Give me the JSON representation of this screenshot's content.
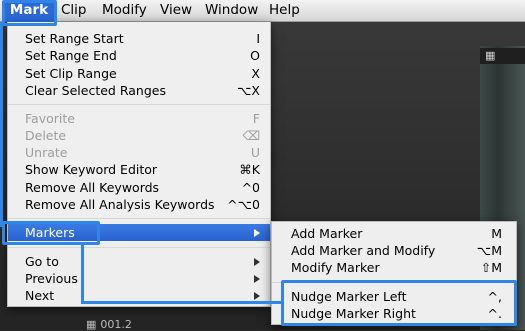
{
  "menubar": {
    "items": [
      {
        "label": "Mark",
        "active": true
      },
      {
        "label": "Clip"
      },
      {
        "label": "Modify"
      },
      {
        "label": "View"
      },
      {
        "label": "Window"
      },
      {
        "label": "Help"
      }
    ]
  },
  "mark_menu": {
    "set_range_start": {
      "label": "Set Range Start",
      "shortcut": "I"
    },
    "set_range_end": {
      "label": "Set Range End",
      "shortcut": "O"
    },
    "set_clip_range": {
      "label": "Set Clip Range",
      "shortcut": "X"
    },
    "clear_selected_ranges": {
      "label": "Clear Selected Ranges",
      "shortcut": "⌥X"
    },
    "favorite": {
      "label": "Favorite",
      "shortcut": "F",
      "enabled": false
    },
    "delete": {
      "label": "Delete",
      "shortcut": "⌫",
      "enabled": false
    },
    "unrate": {
      "label": "Unrate",
      "shortcut": "U",
      "enabled": false
    },
    "show_keyword_editor": {
      "label": "Show Keyword Editor",
      "shortcut": "⌘K"
    },
    "remove_all_keywords": {
      "label": "Remove All Keywords",
      "shortcut": "^0"
    },
    "remove_all_analysis_keywords": {
      "label": "Remove All Analysis Keywords",
      "shortcut": "^⌥0"
    },
    "markers": {
      "label": "Markers",
      "highlighted": true
    },
    "go_to": {
      "label": "Go to"
    },
    "previous": {
      "label": "Previous"
    },
    "next": {
      "label": "Next"
    }
  },
  "markers_submenu": {
    "add_marker": {
      "label": "Add Marker",
      "shortcut": "M"
    },
    "add_marker_and_modify": {
      "label": "Add Marker and Modify",
      "shortcut": "⌥M"
    },
    "modify_marker": {
      "label": "Modify Marker",
      "shortcut": "⇧M"
    },
    "nudge_marker_left": {
      "label": "Nudge Marker Left",
      "shortcut": "^,"
    },
    "nudge_marker_right": {
      "label": "Nudge Marker Right",
      "shortcut": "^."
    }
  },
  "background": {
    "browser_icon": "film-clip-icon",
    "clip_label": "001.2"
  },
  "colors": {
    "menu_highlight": "#2a62d0",
    "annotation_blue": "#2f86e8"
  }
}
